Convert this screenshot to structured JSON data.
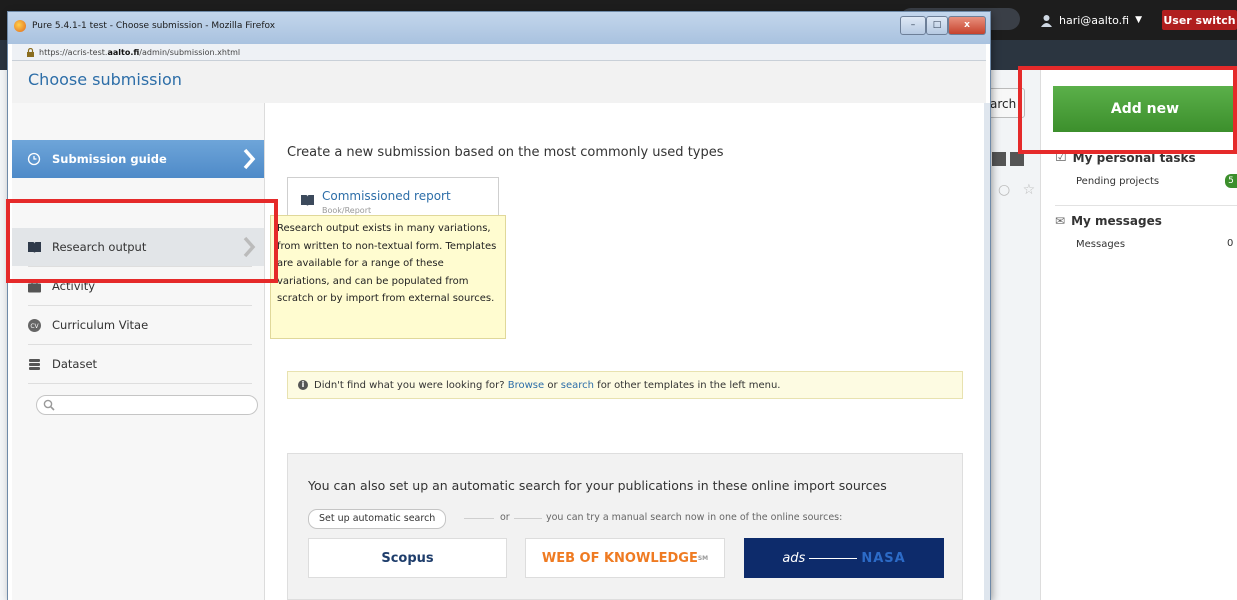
{
  "background": {
    "user_email": "hari@aalto.fi",
    "user_switch_label": "User switch",
    "search_button_label": "arch",
    "add_new_label": "Add new",
    "personal_tasks_title": "My personal tasks",
    "pending_projects_label": "Pending projects",
    "pending_projects_count": "5",
    "messages_title": "My messages",
    "messages_label": "Messages",
    "messages_count": "0"
  },
  "window": {
    "title": "Pure 5.4.1-1 test - Choose submission - Mozilla Firefox",
    "url_prefix": "https://acris-test.",
    "url_domain": "aalto.fi",
    "url_suffix": "/admin/submission.xhtml",
    "minimize_label": "–",
    "maximize_label": "□",
    "close_label": "x"
  },
  "dialog": {
    "title": "Choose submission"
  },
  "sidebar": {
    "items": [
      {
        "label": "Submission guide",
        "icon": "clock-icon"
      },
      {
        "label": "Research output",
        "icon": "book-icon"
      },
      {
        "label": "Activity",
        "icon": "briefcase-icon"
      },
      {
        "label": "Curriculum Vitae",
        "icon": "cv-icon"
      },
      {
        "label": "Dataset",
        "icon": "database-icon"
      }
    ],
    "search_placeholder": ""
  },
  "content": {
    "heading": "Create a new submission based on the most commonly used types",
    "template_title": "Commissioned report",
    "template_subtitle": "Book/Report",
    "tooltip": "Research output exists in many variations, from written to non-textual form. Templates are available for a range of these variations, and can be populated from scratch or by import from external sources.",
    "info_prefix": "Didn't find what you were looking for?",
    "info_browse": "Browse",
    "info_or": "or",
    "info_search": "search",
    "info_suffix": "for other templates in the left menu.",
    "import_heading": "You can also set up an automatic search for your publications in these online import sources",
    "auto_search_button": "Set up automatic search",
    "or_label": "or",
    "manual_text": "you can try a manual search now in one of the online sources:",
    "sources": {
      "scopus": "Scopus",
      "wok": "WEB OF KNOWLEDGE",
      "wok_tm": "SM",
      "ads": "ads",
      "nasa": "NASA"
    }
  },
  "colors": {
    "highlight": "#e52a2a",
    "accent_blue": "#2d6ea8",
    "add_new_green": "#4a9e38",
    "sidebar_active": "#5a95cf"
  }
}
